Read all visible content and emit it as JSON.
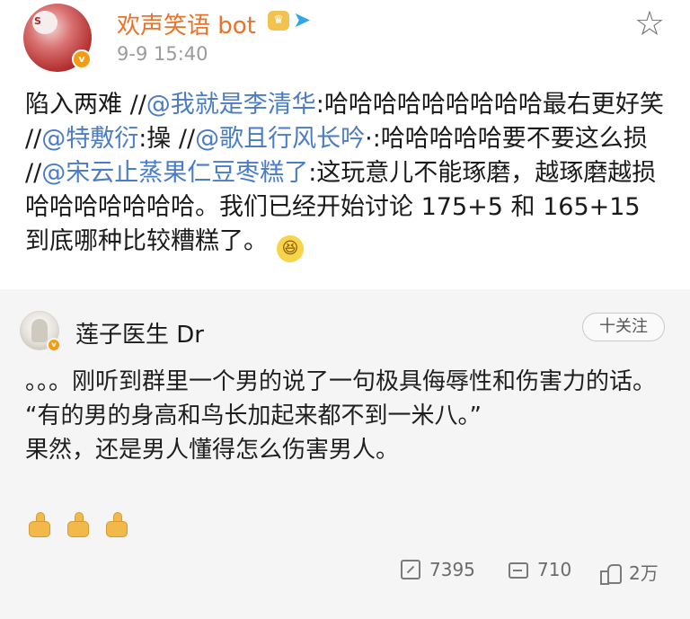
{
  "post": {
    "username": "欢声笑语 bot",
    "timestamp": "9-9 15:40",
    "icons": [
      "crown-badge-icon",
      "paper-plane-icon",
      "star-icon"
    ],
    "body": {
      "s1": "陷入两难",
      "sep1": "//",
      "m1": "@我就是李清华",
      "t1": ":哈哈哈哈哈哈哈哈哈最右更好笑",
      "sep2": "//",
      "m2": "@特敷衍",
      "t2": ":操",
      "sep3": "//",
      "m3": "@歌且行风长吟",
      "t3": "·:哈哈哈哈哈要不要这么损",
      "sep4": "//",
      "m4": "@宋云止蒸果仁豆枣糕了",
      "t4": ":这玩意儿不能琢磨，越琢磨越损哈哈哈哈哈哈哈。我们已经开始讨论 175+5 和 165+15 到底哪种比较糟糕了。"
    },
    "emoji": "laughing-emoji"
  },
  "comment": {
    "username": "莲子医生 Dr",
    "follow_label": "十关注",
    "lines": {
      "l1": "。。。刚听到群里一个男的说了一句极具侮辱性和伤害力的话。",
      "l2": "“有的男的身高和鸟长加起来都不到一米八。”",
      "l3": "果然，还是男人懂得怎么伤害男人。"
    },
    "emoji": [
      "thumbs-up-icon",
      "thumbs-up-icon",
      "thumbs-up-icon"
    ]
  },
  "stats": {
    "reposts": "7395",
    "comments": "710",
    "likes": "2万"
  },
  "colors": {
    "username_orange": "#e8732a",
    "mention_blue": "#4a7cc7",
    "comment_bg": "#f5f5f5",
    "muted_text": "#9b9b9b"
  }
}
